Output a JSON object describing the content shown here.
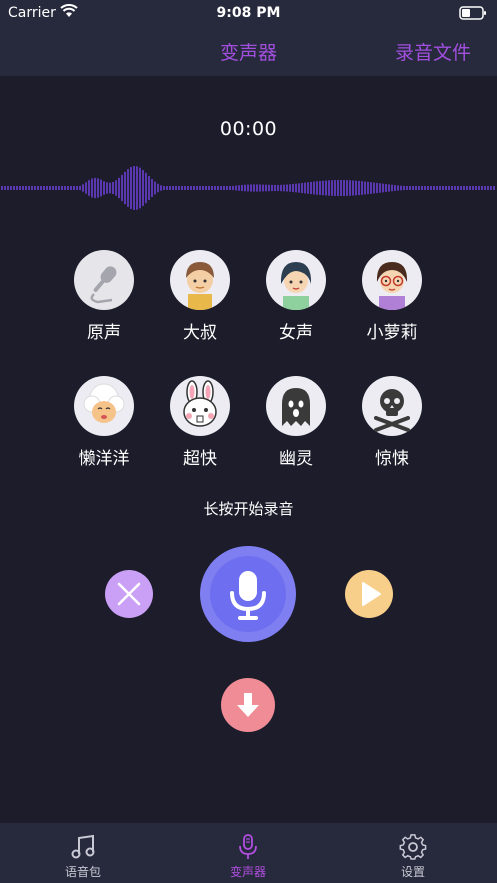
{
  "status_bar": {
    "carrier": "Carrier",
    "time": "9:08 PM"
  },
  "nav": {
    "title": "变声器",
    "right_button": "录音文件"
  },
  "timer": "00:00",
  "effects": [
    {
      "label": "原声",
      "icon": "microphone-icon"
    },
    {
      "label": "大叔",
      "icon": "uncle-avatar-icon"
    },
    {
      "label": "女声",
      "icon": "woman-avatar-icon"
    },
    {
      "label": "小萝莉",
      "icon": "girl-avatar-icon"
    },
    {
      "label": "懒洋洋",
      "icon": "sheep-avatar-icon"
    },
    {
      "label": "超快",
      "icon": "rabbit-avatar-icon"
    },
    {
      "label": "幽灵",
      "icon": "ghost-icon"
    },
    {
      "label": "惊悚",
      "icon": "skull-icon"
    }
  ],
  "hint": "长按开始录音",
  "tabs": [
    {
      "label": "语音包",
      "icon": "music-note-icon",
      "active": false
    },
    {
      "label": "变声器",
      "icon": "microphone-icon",
      "active": true
    },
    {
      "label": "设置",
      "icon": "gear-icon",
      "active": false
    }
  ],
  "colors": {
    "accent": "#a24fe0",
    "background": "#1c1c2b",
    "bar": "#272a3c",
    "record": "#7f7ff2",
    "cancel": "#c9a0f5",
    "play": "#f8cf8a",
    "download": "#f08c95"
  }
}
